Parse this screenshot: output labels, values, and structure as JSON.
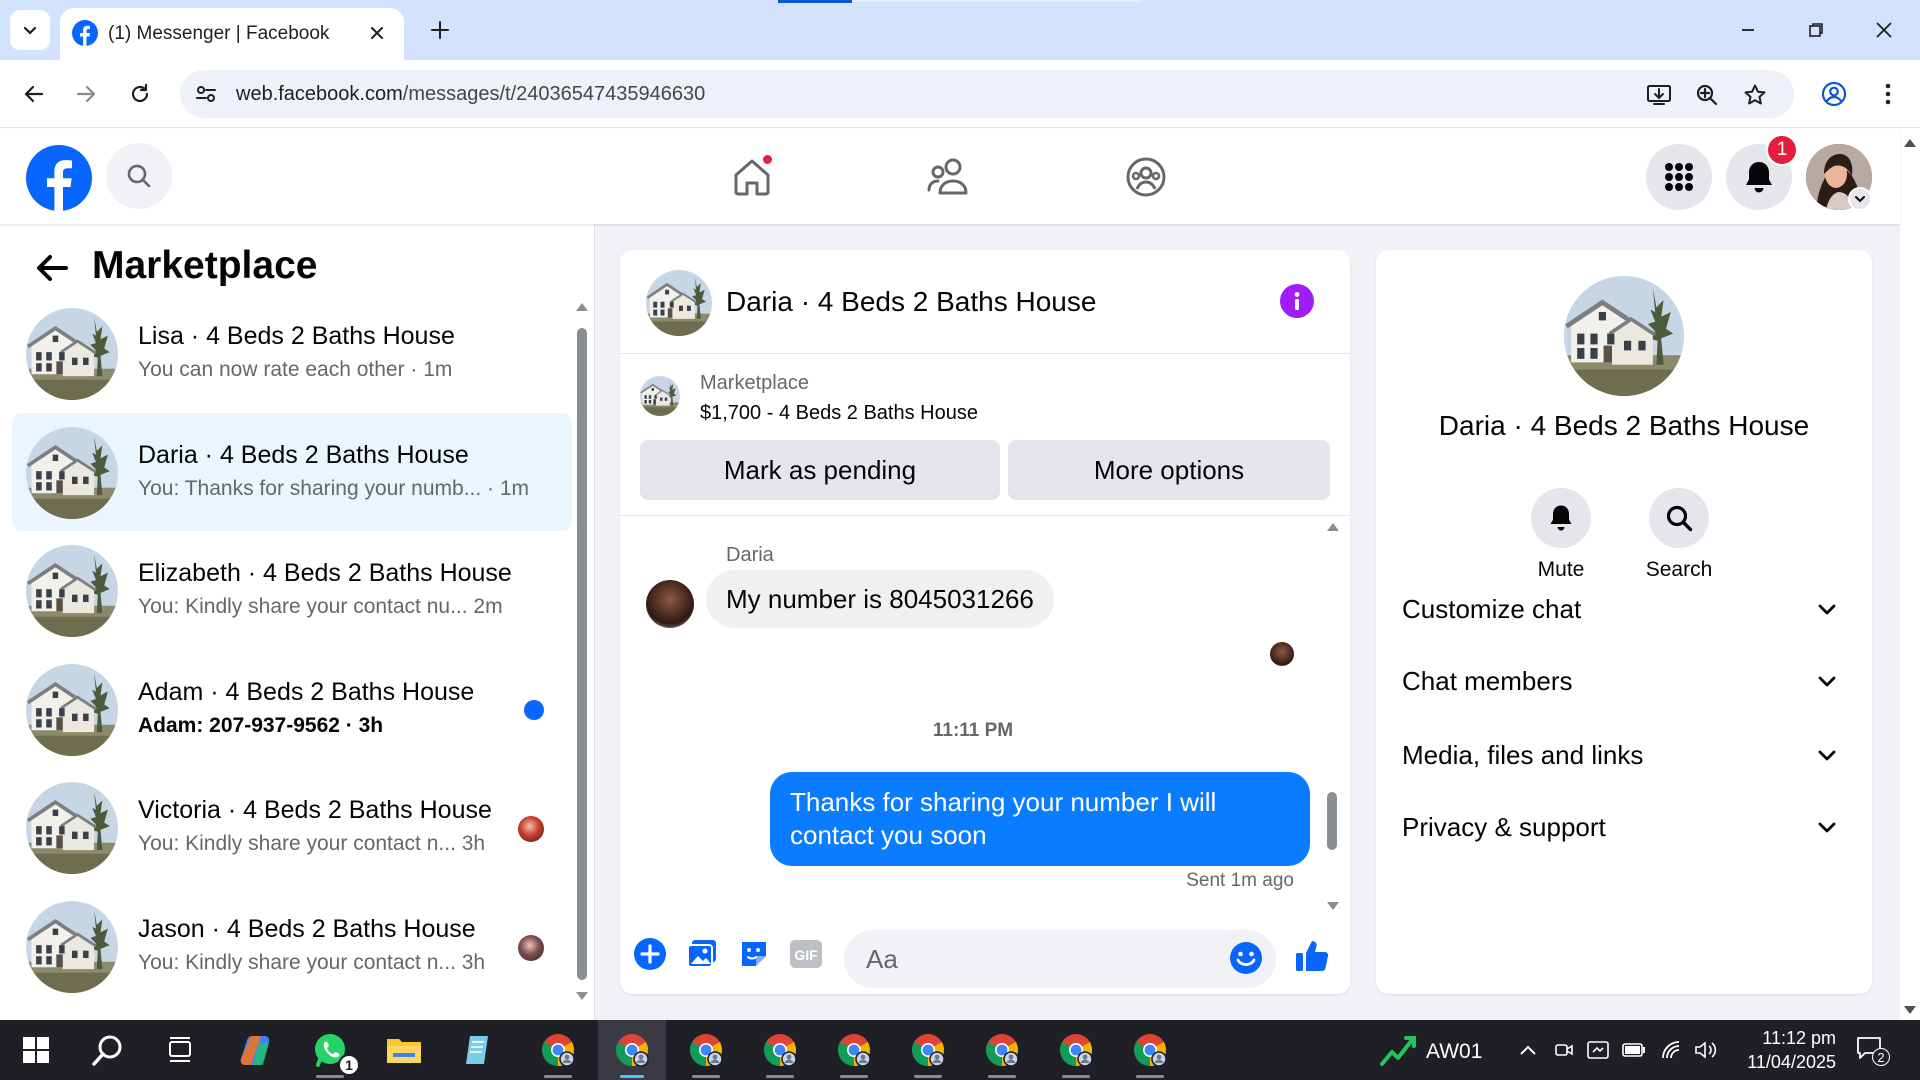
{
  "browser": {
    "tab_title": "(1) Messenger | Facebook",
    "url_domain": "web.facebook.com",
    "url_path": "/messages/t/24036547435946630"
  },
  "fb_header": {
    "notification_count": "1",
    "active_nav": "home",
    "home_has_dot": true
  },
  "left_panel": {
    "title": "Marketplace",
    "conversations": [
      {
        "name": "Lisa · 4 Beds 2 Baths House",
        "preview": "You can now rate each other · 1m",
        "active": false,
        "unread": false
      },
      {
        "name": "Daria · 4 Beds 2 Baths House",
        "preview": "You: Thanks for sharing your numb... · 1m",
        "active": true,
        "unread": false
      },
      {
        "name": "Elizabeth · 4 Beds 2 Baths House",
        "preview": "You: Kindly share your contact nu...   2m",
        "active": false,
        "unread": false
      },
      {
        "name": "Adam · 4 Beds 2 Baths House",
        "preview": "Adam: 207-937-9562 · 3h",
        "active": false,
        "unread": true
      },
      {
        "name": "Victoria · 4 Beds 2 Baths House",
        "preview": "You: Kindly share your contact n...   3h",
        "active": false,
        "unread": false
      },
      {
        "name": "Jason · 4 Beds 2 Baths House",
        "preview": "You: Kindly share your contact n...   3h",
        "active": false,
        "unread": false
      }
    ]
  },
  "chat": {
    "title": "Daria · 4 Beds 2 Baths House",
    "listing": {
      "source": "Marketplace",
      "title": "$1,700 - 4 Beds 2 Baths House",
      "btn_pending": "Mark as pending",
      "btn_more": "More options"
    },
    "messages": {
      "sender": "Daria",
      "incoming": "My number is 8045031266",
      "time": "11:11 PM",
      "outgoing": "Thanks for sharing your number I will contact you soon",
      "status": "Sent 1m ago"
    },
    "composer_placeholder": "Aa",
    "gif_label": "GIF"
  },
  "info_panel": {
    "name": "Daria · 4 Beds 2 Baths House",
    "actions": {
      "mute": "Mute",
      "search": "Search"
    },
    "sections": [
      "Customize chat",
      "Chat members",
      "Media, files and links",
      "Privacy & support"
    ]
  },
  "taskbar": {
    "whatsapp_badge": "1",
    "aw_label": "AW01",
    "time": "11:12 pm",
    "date": "11/04/2025",
    "notif_count": "2"
  },
  "colors": {
    "fb_blue": "#0866ff",
    "messenger_blue": "#0a7cff",
    "info_purple": "#a01df7",
    "badge_red": "#e41e3f",
    "active_row": "#ebf5ff"
  }
}
